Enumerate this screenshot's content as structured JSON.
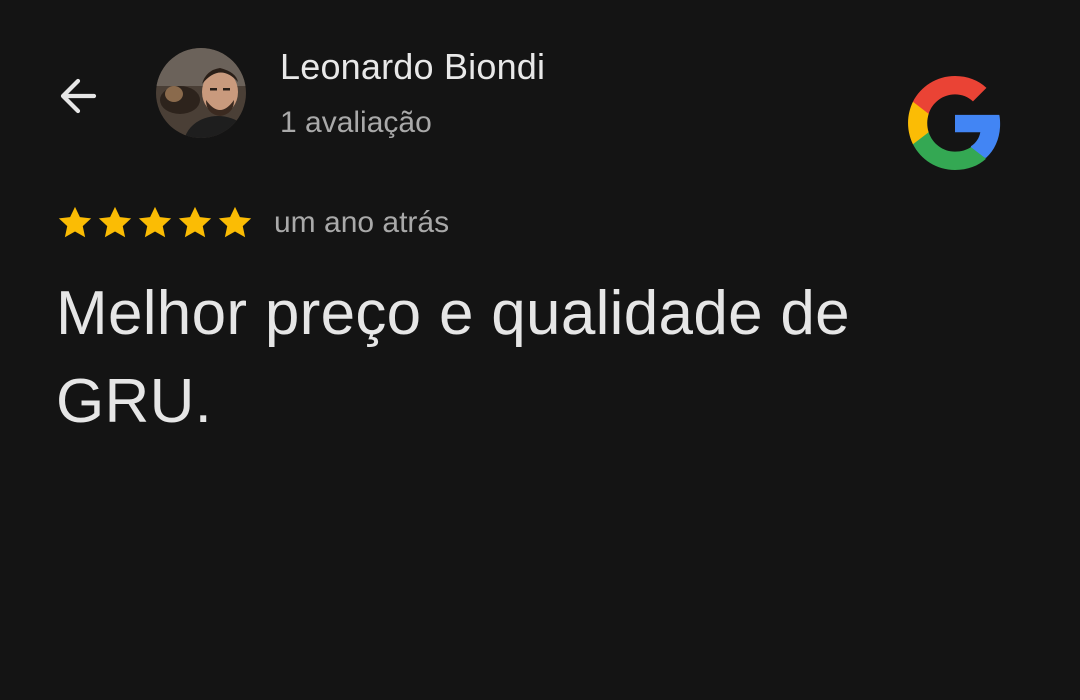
{
  "header": {
    "back_icon": "arrow-left-icon",
    "reviewer_name": "Leonardo Biondi",
    "review_count": "1 avaliação",
    "avatar": "reviewer-photo",
    "brand_logo": "google-g-icon"
  },
  "review": {
    "rating": 5,
    "rating_max": 5,
    "star_color": "#fbbc04",
    "time": "um ano atrás",
    "text": "Melhor preço e qualidade de GRU."
  },
  "colors": {
    "background": "#141414",
    "primary_text": "#e6e6e6",
    "secondary_text": "#a9a9a9",
    "google_red": "#ea4335",
    "google_yellow": "#fbbc05",
    "google_green": "#34a853",
    "google_blue": "#4285f4"
  }
}
